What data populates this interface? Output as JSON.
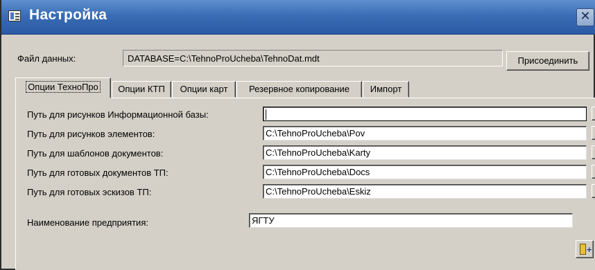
{
  "window": {
    "title": "Настройка",
    "close_glyph": "✕"
  },
  "data_file": {
    "label": "Файл данных:",
    "value": "DATABASE=C:\\TehnoProUcheba\\TehnoDat.mdt",
    "connect_label": "Присоединить"
  },
  "tabs": [
    {
      "label": "Опции ТехноПро",
      "active": true
    },
    {
      "label": "Опции КТП",
      "active": false
    },
    {
      "label": "Опции карт",
      "active": false
    },
    {
      "label": "Резервное копирование",
      "active": false
    },
    {
      "label": "Импорт",
      "active": false
    }
  ],
  "paths": [
    {
      "label": "Путь для рисунков Информационной базы:",
      "value": ""
    },
    {
      "label": "Путь для рисунков элементов:",
      "value": "C:\\TehnoProUcheba\\Pov"
    },
    {
      "label": "Путь для шаблонов документов:",
      "value": "C:\\TehnoProUcheba\\Karty"
    },
    {
      "label": "Путь для готовых документов ТП:",
      "value": "C:\\TehnoProUcheba\\Docs"
    },
    {
      "label": "Путь для готовых эскизов ТП:",
      "value": "C:\\TehnoProUcheba\\Eskiz"
    }
  ],
  "browse_glyph": "...",
  "enterprise": {
    "label": "Наименование предприятия:",
    "value": "ЯГТУ"
  },
  "icons": {
    "window_icon": "form-icon",
    "exit_icon": "exit-door-icon"
  }
}
